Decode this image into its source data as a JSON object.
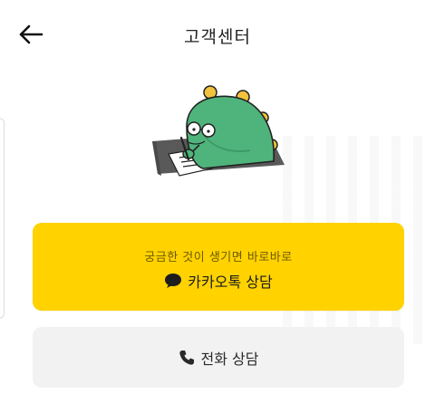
{
  "header": {
    "title": "고객센터",
    "back_icon": "arrow-left-icon"
  },
  "mascot": {
    "icon": "dinosaur-writing-illustration"
  },
  "kakao": {
    "subtitle": "궁금한 것이 생기면 바로바로",
    "label": "카카오톡 상담",
    "icon": "chat-bubble-icon",
    "color": "#ffd200"
  },
  "phone": {
    "label": "전화 상담",
    "icon": "phone-icon",
    "color": "#f2f2f2"
  }
}
